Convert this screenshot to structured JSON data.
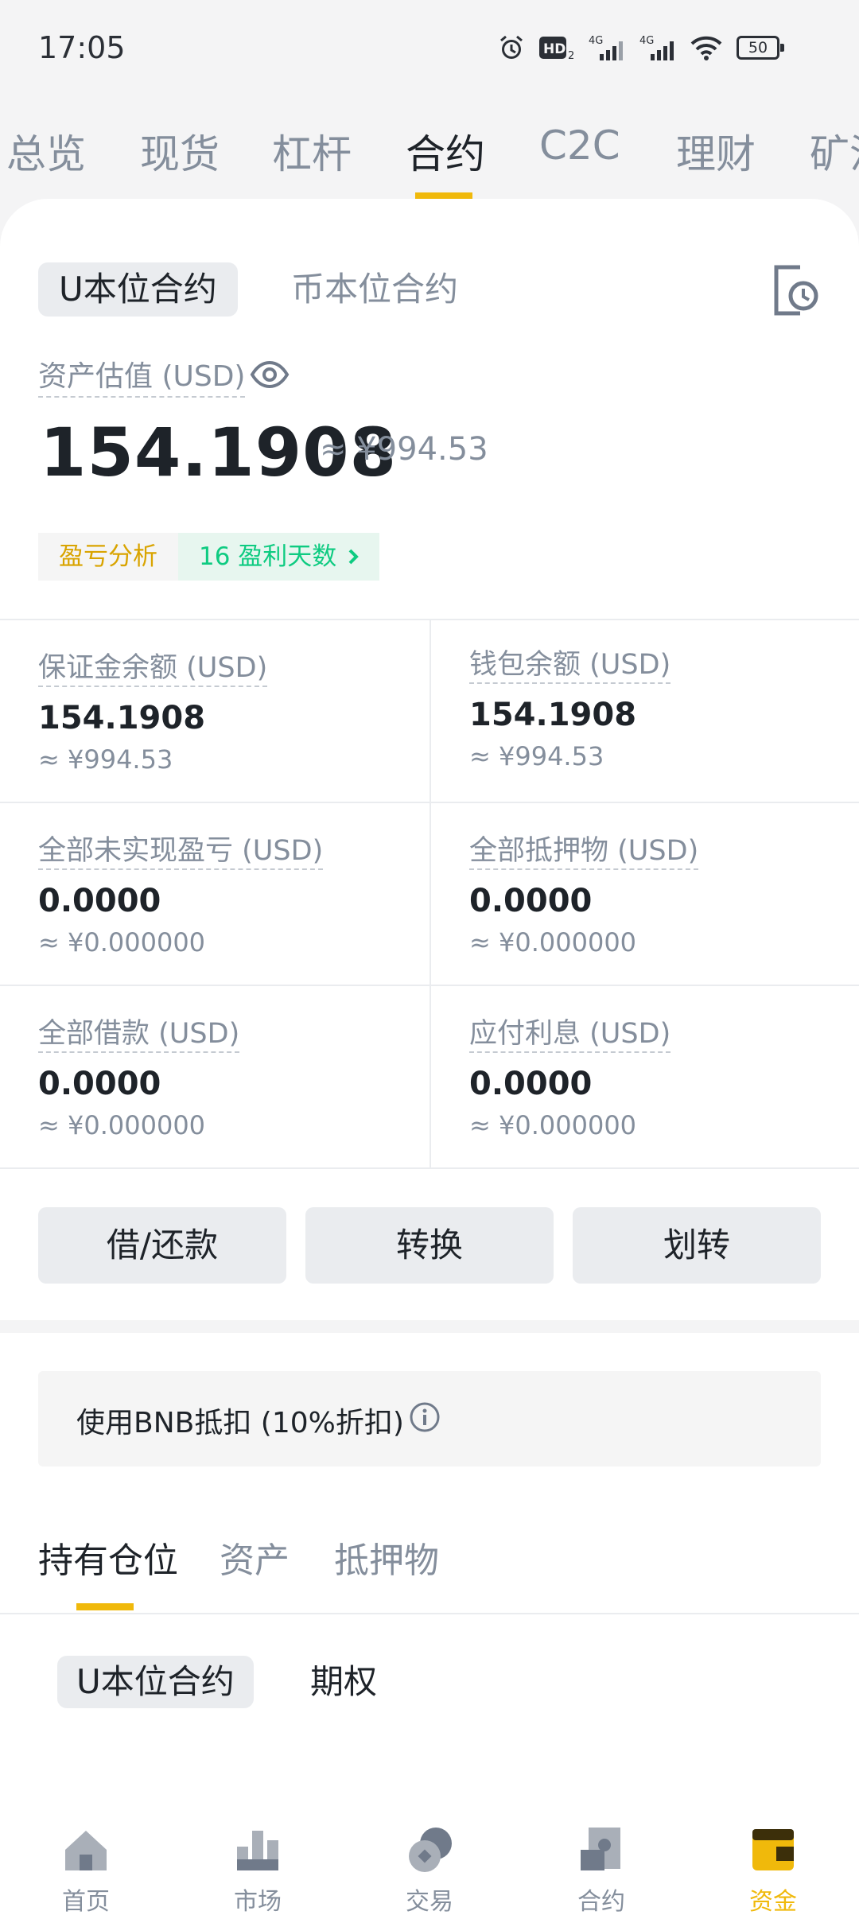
{
  "status_bar": {
    "time": "17:05",
    "battery": "50",
    "network": "4G"
  },
  "top_tabs": [
    "总览",
    "现货",
    "杠杆",
    "合约",
    "C2C",
    "理财",
    "矿池"
  ],
  "top_tab_active": "合约",
  "sub_tabs": [
    "U本位合约",
    "币本位合约"
  ],
  "asset_estimate": {
    "label": "资产估值 (USD)",
    "value": "154.1908",
    "approx": "≈ ¥994.53"
  },
  "pnl": {
    "analysis": "盈亏分析",
    "days": "16 盈利天数"
  },
  "balances": [
    {
      "label": "保证金余额 (USD)",
      "value": "154.1908",
      "approx": "≈ ¥994.53"
    },
    {
      "label": "钱包余额 (USD)",
      "value": "154.1908",
      "approx": "≈ ¥994.53"
    },
    {
      "label": "全部未实现盈亏 (USD)",
      "value": "0.0000",
      "approx": "≈ ¥0.000000"
    },
    {
      "label": "全部抵押物 (USD)",
      "value": "0.0000",
      "approx": "≈ ¥0.000000"
    },
    {
      "label": "全部借款 (USD)",
      "value": "0.0000",
      "approx": "≈ ¥0.000000"
    },
    {
      "label": "应付利息 (USD)",
      "value": "0.0000",
      "approx": "≈ ¥0.000000"
    }
  ],
  "actions": [
    "借/还款",
    "转换",
    "划转"
  ],
  "bnb_deduction": "使用BNB抵扣 (10%折扣)",
  "position_tabs": [
    "持有仓位",
    "资产",
    "抵押物"
  ],
  "inner_tabs": [
    "U本位合约",
    "期权"
  ],
  "bottom_nav": [
    "首页",
    "市场",
    "交易",
    "合约",
    "资金"
  ],
  "colors": {
    "accent": "#f0b90b",
    "profit": "#0ecb81",
    "text": "#1e2329",
    "muted": "#848e9c"
  }
}
